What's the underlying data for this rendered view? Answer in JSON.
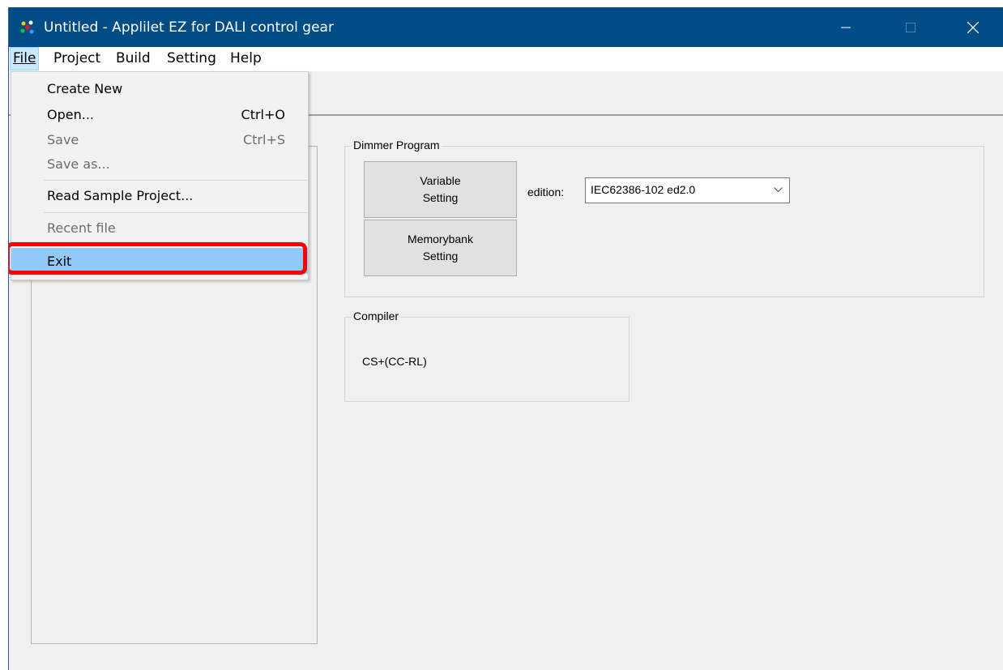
{
  "window": {
    "title": "Untitled - Applilet EZ for DALI control gear",
    "controls": {
      "minimize": "minimize-icon",
      "maximize": "maximize-icon",
      "close": "close-icon"
    }
  },
  "menubar": {
    "items": [
      {
        "label": "File",
        "mnemonic": "F"
      },
      {
        "label": "Project",
        "mnemonic": "P"
      },
      {
        "label": "Build",
        "mnemonic": "B"
      },
      {
        "label": "Setting",
        "mnemonic": "S"
      },
      {
        "label": "Help",
        "mnemonic": "H"
      }
    ]
  },
  "file_menu": {
    "items": [
      {
        "label": "Create New",
        "shortcut": "",
        "enabled": true
      },
      {
        "label": "Open...",
        "shortcut": "Ctrl+O",
        "enabled": true
      },
      {
        "label": "Save",
        "shortcut": "Ctrl+S",
        "enabled": false
      },
      {
        "label": "Save as...",
        "shortcut": "",
        "enabled": false
      },
      {
        "label": "Read Sample Project...",
        "shortcut": "",
        "enabled": true
      },
      {
        "label": "Recent file",
        "shortcut": "",
        "enabled": false
      },
      {
        "label": "Exit",
        "shortcut": "",
        "enabled": true,
        "highlighted": true
      }
    ]
  },
  "dimmer": {
    "legend": "Dimmer Program",
    "variable_button": "Variable\nSetting",
    "memorybank_button": "Memorybank\nSetting",
    "edition_label": "edition:",
    "edition_value": "IEC62386-102 ed2.0"
  },
  "compiler": {
    "legend": "Compiler",
    "value": "CS+(CC-RL)"
  },
  "colors": {
    "titlebar": "#004c87",
    "highlight": "#91c9f7",
    "annotation": "#ff0000"
  }
}
